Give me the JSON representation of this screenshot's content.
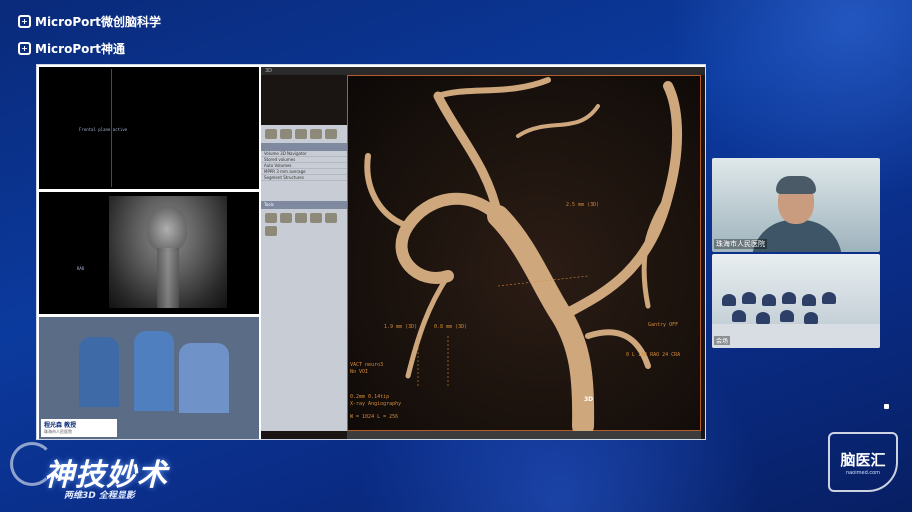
{
  "branding": {
    "line1": "MicroPort微创脑科学",
    "line2": "MicroPort神通"
  },
  "left_panes": {
    "top_text": "Frontal plane active",
    "mid_text": "RAO",
    "surgeon_caption_name": "程光森 教授",
    "surgeon_caption_hospital": "珠海市人民医院"
  },
  "viewer": {
    "title": "3D",
    "measurements": [
      "2.5 mm (3D)",
      "1.9 mm (3D)",
      "0.8 mm (3D)"
    ],
    "overlay_left": [
      "VACT neuro3",
      "No VOI",
      "0.2mm 0.14tip",
      "X-ray Angiography",
      "W = 1024 L = 256"
    ],
    "overlay_right": "Gantry OFF",
    "overlay_angle": "0 L 138 RAO 24 CRA",
    "label_3d": "3D",
    "panel_rows": [
      "Volume 3D Navigator",
      "Stored volumes",
      "Auto Volumes",
      "MPPR 3 mm average",
      "Segment Structures"
    ],
    "tools_label": "Tools"
  },
  "cameras": {
    "cam1_label": "珠海市人民医院",
    "cam2_label": "会场"
  },
  "event": {
    "title": "神技妙术",
    "subtitle": "两维3D 全程显影"
  },
  "badge": {
    "name": "脑医汇",
    "url": "naoimed.com"
  },
  "colors": {
    "background": "#0b3a9e",
    "accent_orange": "#d48a3a"
  }
}
